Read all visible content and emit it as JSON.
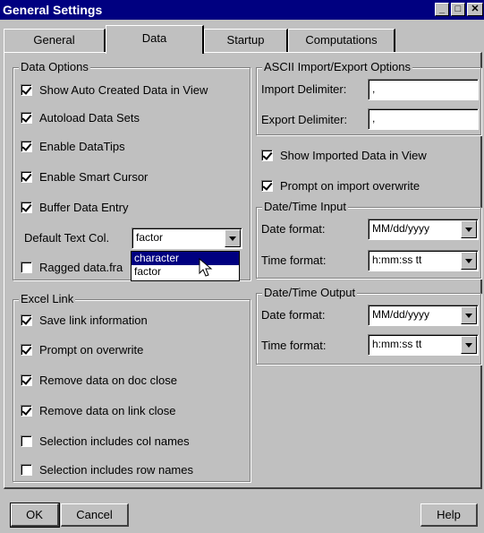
{
  "window": {
    "title": "General Settings"
  },
  "tabs": [
    {
      "label": "General"
    },
    {
      "label": "Data"
    },
    {
      "label": "Startup"
    },
    {
      "label": "Computations"
    }
  ],
  "data_options": {
    "title": "Data Options",
    "items": [
      {
        "label": "Show Auto Created Data in View",
        "checked": true
      },
      {
        "label": "Autoload Data Sets",
        "checked": true
      },
      {
        "label": "Enable DataTips",
        "checked": true
      },
      {
        "label": "Enable Smart Cursor",
        "checked": true
      },
      {
        "label": "Buffer Data Entry",
        "checked": true
      }
    ],
    "default_text_col_label": "Default Text Col.",
    "default_text_col_value": "factor",
    "dropdown_options": [
      "character",
      "factor"
    ],
    "ragged_label": "Ragged data.fra",
    "ragged_checked": false
  },
  "excel_link": {
    "title": "Excel Link",
    "items": [
      {
        "label": "Save link information",
        "checked": true
      },
      {
        "label": "Prompt on overwrite",
        "checked": true
      },
      {
        "label": "Remove data on doc close",
        "checked": true
      },
      {
        "label": "Remove data on link close",
        "checked": true
      },
      {
        "label": "Selection includes col names",
        "checked": false
      },
      {
        "label": "Selection includes row names",
        "checked": false
      }
    ]
  },
  "ascii": {
    "title": "ASCII Import/Export Options",
    "import_label": "Import Delimiter:",
    "import_value": ",",
    "export_label": "Export Delimiter:",
    "export_value": ","
  },
  "import_opts": [
    {
      "label": "Show Imported Data in View",
      "checked": true
    },
    {
      "label": "Prompt on import overwrite",
      "checked": true
    }
  ],
  "dt_input": {
    "title": "Date/Time Input",
    "date_label": "Date format:",
    "date_value": "MM/dd/yyyy",
    "time_label": "Time format:",
    "time_value": "h:mm:ss tt"
  },
  "dt_output": {
    "title": "Date/Time Output",
    "date_label": "Date format:",
    "date_value": "MM/dd/yyyy",
    "time_label": "Time format:",
    "time_value": "h:mm:ss tt"
  },
  "buttons": {
    "ok": "OK",
    "cancel": "Cancel",
    "help": "Help"
  }
}
